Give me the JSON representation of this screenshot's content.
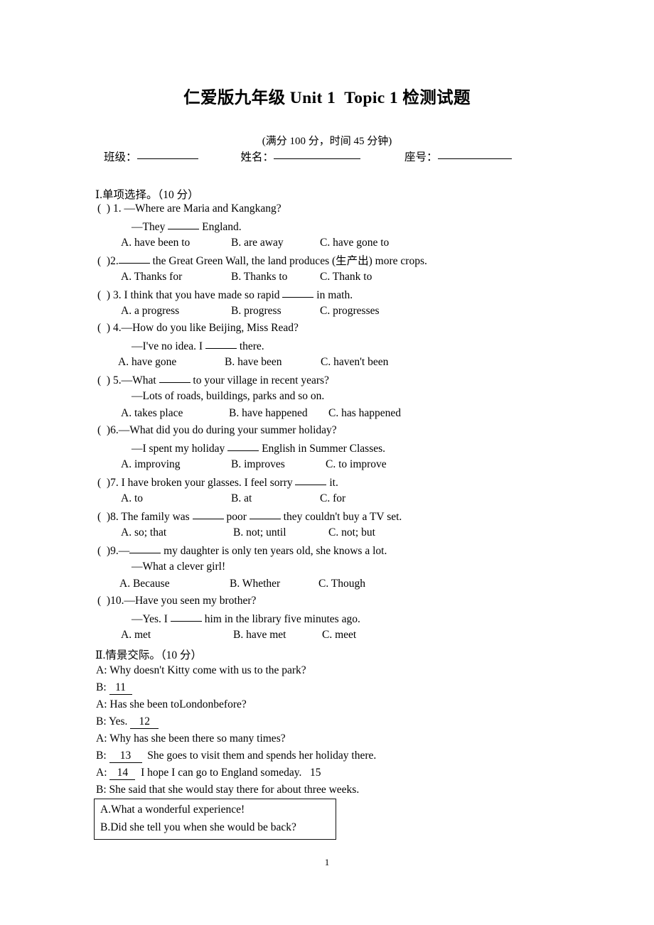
{
  "document": {
    "title": "仁爱版九年级 Unit 1  Topic 1 检测试题",
    "subtitle": "(满分 100 分，时间 45 分钟)",
    "page_number": "1"
  },
  "identity": {
    "class_label": "班级：",
    "name_label": "姓名：",
    "seat_label": "座号："
  },
  "section1": {
    "heading": "Ⅰ.单项选择。（10 分）",
    "questions": [
      {
        "stem": "(  ) 1. —Where are Maria and Kangkang?",
        "cont": "—They ",
        "cont_tail": " England.",
        "options": [
          "A. have been to",
          "B. are away",
          "C. have gone to"
        ]
      },
      {
        "stem_pre": "(  )2.",
        "stem_post": " the Great Green Wall, the land produces (生产出) more crops.",
        "options": [
          "A. Thanks for",
          "B. Thanks to",
          "C. Thank to"
        ]
      },
      {
        "stem_pre": "(  ) 3. I think that you have made so rapid ",
        "stem_post": " in math.",
        "options": [
          "A. a progress",
          "B. progress",
          "C. progresses"
        ]
      },
      {
        "stem": "(  ) 4.—How do you like Beijing, Miss Read?",
        "cont": "—I've no idea. I ",
        "cont_tail": " there.",
        "options": [
          "A. have gone",
          "B. have been",
          "C. haven't been"
        ]
      },
      {
        "stem_pre": "(  ) 5.—What ",
        "stem_post": " to your village in recent years?",
        "cont": "—Lots of roads, buildings, parks and so on.",
        "options": [
          "A. takes place",
          "B. have happened",
          "C. has happened"
        ]
      },
      {
        "stem": "(  )6.—What did you do during your summer holiday?",
        "cont": "—I spent my holiday ",
        "cont_tail": " English in Summer Classes.",
        "options": [
          "A. improving",
          "B. improves",
          "C. to improve"
        ]
      },
      {
        "stem_pre": "(  )7. I have broken your glasses. I feel sorry ",
        "stem_post": " it.",
        "options": [
          "A. to",
          "B. at",
          "C. for"
        ]
      },
      {
        "stem_pre": "(  )8. The family was ",
        "stem_mid": " poor ",
        "stem_post": " they couldn't buy a TV set.",
        "options": [
          "A. so; that",
          "B. not; until",
          "C. not; but"
        ]
      },
      {
        "stem_pre": "(  )9.—",
        "stem_post": " my daughter is only ten years old, she knows a lot.",
        "cont": "—What a clever girl!",
        "options": [
          "A. Because",
          "B. Whether",
          "C. Though"
        ]
      },
      {
        "stem": "(  )10.—Have you seen my brother?",
        "cont": "—Yes. I ",
        "cont_tail": " him in the library five minutes ago.",
        "options": [
          "A. met",
          "B. have met",
          "C. meet"
        ]
      }
    ]
  },
  "section2": {
    "heading": "Ⅱ.情景交际。（10 分）",
    "dialogue": [
      {
        "speaker": "A: ",
        "text": "Why doesn't Kitty come with us to the park?"
      },
      {
        "speaker": "B: ",
        "blank": "11",
        "text": ""
      },
      {
        "speaker": "A: ",
        "text": "Has she been toLondonbefore?"
      },
      {
        "speaker": "B: ",
        "pre": "Yes. ",
        "blank": "12",
        "text": ""
      },
      {
        "speaker": "A: ",
        "text": "Why has she been there so many times?"
      },
      {
        "speaker": "B: ",
        "blank": "13",
        "text": "  She goes to visit them and spends her holiday there."
      },
      {
        "speaker": "A: ",
        "blank": "14",
        "text": "  I hope I can go to England someday.   15"
      },
      {
        "speaker": "B: ",
        "text": "She said that she would stay there for about three weeks."
      }
    ],
    "choice_box": [
      "A.What a wonderful experience!",
      "B.Did she tell you when she would be back?"
    ]
  }
}
